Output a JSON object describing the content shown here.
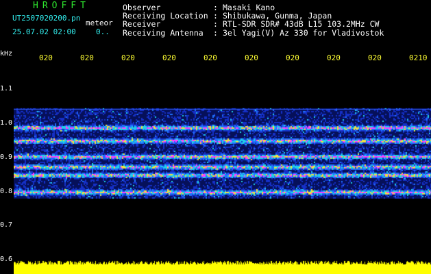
{
  "header": {
    "logo": "HROFFT",
    "file_name": "UT2507020200.pn",
    "meteor_label": "meteor",
    "datetime": "25.07.02 02:00",
    "datetime_extra": "0..",
    "info_rows": [
      {
        "key": "Observer",
        "value": "Masaki Kano"
      },
      {
        "key": "Receiving Location",
        "value": "Shibukawa, Gunma, Japan"
      },
      {
        "key": "Receiver",
        "value": "RTL-SDR SDR# 43dB L15 103.2MHz CW"
      },
      {
        "key": "Receiving Antenna",
        "value": "3el Yagi(V) Az 330 for Vladivostok"
      }
    ],
    "separator": ":"
  },
  "axes": {
    "y_unit": "kHz",
    "y_ticks": [
      "1.1",
      "1.0",
      "0.9",
      "0.8",
      "0.7",
      "0.6"
    ],
    "x_ticks": [
      "020",
      "020",
      "020",
      "020",
      "020",
      "020",
      "020",
      "020",
      "020",
      "0210"
    ]
  },
  "colors": {
    "background": "#000000",
    "axis_text": "#ffffff",
    "time_labels": "#ffff33",
    "logo": "#2ee62e",
    "file_text": "#33f0f0",
    "spectrogram_low": "#0a1a8c",
    "spectrogram_mid": "#20c0e0",
    "spectrogram_high": "#ff40ff",
    "signal_bar": "#ffff00"
  }
}
